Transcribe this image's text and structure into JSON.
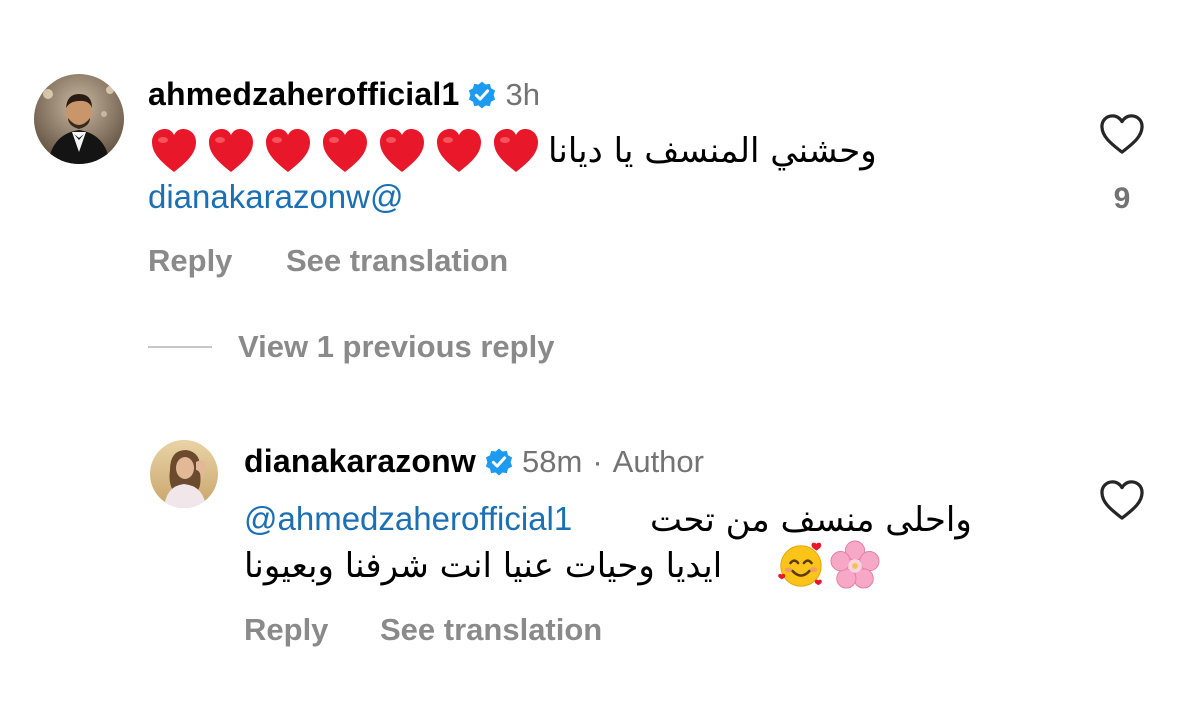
{
  "comment": {
    "username": "ahmedzaherofficial1",
    "time": "3h",
    "text": "وحشني المنسف يا ديانا",
    "emoji": "❤️❤️❤️❤️❤️❤️❤️",
    "mention": "dianakarazonw@",
    "reply_label": "Reply",
    "translate_label": "See translation",
    "like_count": "9"
  },
  "view_replies_label": "View 1 previous reply",
  "reply": {
    "username": "dianakarazonw",
    "time": "58m",
    "separator": "·",
    "author_label": "Author",
    "mention": "@ahmedzaherofficial1",
    "line1": "واحلى منسف من تحت",
    "line2": "ايديا وحيات عنيا انت شرفنا وبعيونا",
    "emoji": "🌸🥰",
    "reply_label": "Reply",
    "translate_label": "See translation"
  },
  "colors": {
    "verified": "#1d9bf0",
    "mention": "#1b6fb5",
    "secondary": "#8a8a8a",
    "heart": "#e8182a"
  }
}
